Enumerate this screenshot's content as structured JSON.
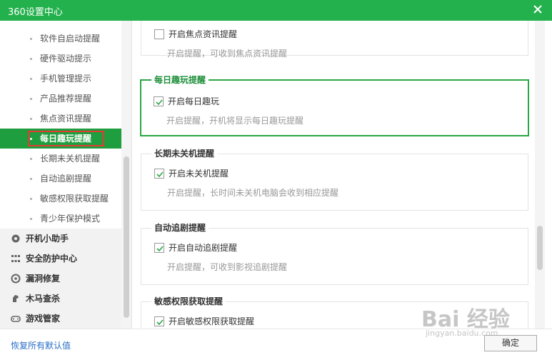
{
  "window": {
    "title": "360设置中心",
    "close_icon": "close-icon"
  },
  "sidebar": {
    "sub_items": [
      {
        "label": "软件自启动提醒",
        "active": false
      },
      {
        "label": "硬件驱动提示",
        "active": false
      },
      {
        "label": "手机管理提示",
        "active": false
      },
      {
        "label": "产品推荐提醒",
        "active": false
      },
      {
        "label": "焦点资讯提醒",
        "active": false
      },
      {
        "label": "每日趣玩提醒",
        "active": true
      },
      {
        "label": "长期未关机提醒",
        "active": false
      },
      {
        "label": "自动追剧提醒",
        "active": false
      },
      {
        "label": "敏感权限获取提醒",
        "active": false
      },
      {
        "label": "青少年保护模式",
        "active": false
      }
    ],
    "categories": [
      {
        "label": "开机小助手",
        "icon": "startup-gear-icon"
      },
      {
        "label": "安全防护中心",
        "icon": "shield-grid-icon"
      },
      {
        "label": "漏洞修复",
        "icon": "patch-icon"
      },
      {
        "label": "木马查杀",
        "icon": "trojan-icon"
      },
      {
        "label": "游戏管家",
        "icon": "gamepad-icon"
      }
    ]
  },
  "groups": [
    {
      "legend": "",
      "checkbox_label": "开启焦点资讯提醒",
      "checked": false,
      "description": "开启提醒，可收到焦点资讯提醒"
    },
    {
      "legend": "每日趣玩提醒",
      "checkbox_label": "开启每日趣玩",
      "checked": true,
      "description": "开启提醒，开机将显示每日趣玩提醒",
      "selected": true
    },
    {
      "legend": "长期未关机提醒",
      "checkbox_label": "开启未关机提醒",
      "checked": true,
      "description": "开启提醒，长时间未关机电脑会收到相应提醒"
    },
    {
      "legend": "自动追剧提醒",
      "checkbox_label": "开启自动追剧提醒",
      "checked": true,
      "description": "开启提醒，可收到影视追剧提醒"
    },
    {
      "legend": "敏感权限获取提醒",
      "checkbox_label": "开启敏感权限获取提醒",
      "checked": true,
      "description": ""
    }
  ],
  "footer": {
    "restore_link": "恢复所有默认值",
    "ok_button": "确定"
  },
  "watermark": {
    "text": "Bai 经验",
    "url_text": "jingyan.baidu.com"
  },
  "colors": {
    "brand_green": "#23b14d",
    "active_green": "#1e9e3e",
    "highlight_red": "#e53935",
    "link_blue": "#2a6ec6"
  }
}
